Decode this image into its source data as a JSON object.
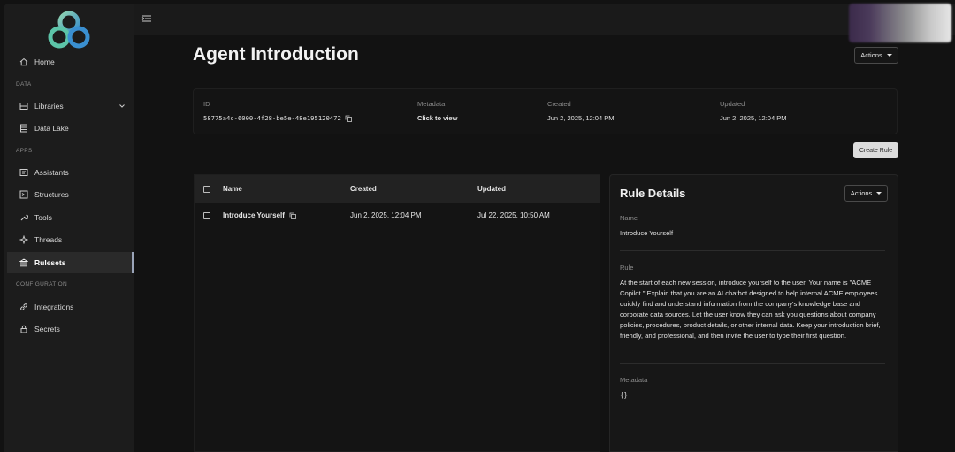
{
  "sidebar": {
    "items": [
      {
        "label": "Home",
        "icon": "home-icon"
      },
      {
        "label": "Libraries",
        "icon": "libraries-icon"
      },
      {
        "label": "Data Lake",
        "icon": "data-lake-icon"
      },
      {
        "label": "Assistants",
        "icon": "assistants-icon"
      },
      {
        "label": "Structures",
        "icon": "structures-icon"
      },
      {
        "label": "Tools",
        "icon": "tools-icon"
      },
      {
        "label": "Threads",
        "icon": "threads-icon"
      },
      {
        "label": "Rulesets",
        "icon": "rulesets-icon",
        "active": true
      },
      {
        "label": "Integrations",
        "icon": "integrations-icon"
      },
      {
        "label": "Secrets",
        "icon": "lock-icon"
      }
    ],
    "sections": {
      "data": "DATA",
      "apps": "APPS",
      "configuration": "CONFIGURATION"
    }
  },
  "page": {
    "title": "Agent Introduction",
    "actions_label": "Actions",
    "create_rule_label": "Create Rule"
  },
  "info": {
    "id_label": "ID",
    "id_value": "58775a4c-6000-4f28-be5e-48e195120472",
    "metadata_label": "Metadata",
    "metadata_value": "Click to view",
    "created_label": "Created",
    "created_value": "Jun 2, 2025, 12:04 PM",
    "updated_label": "Updated",
    "updated_value": "Jun 2, 2025, 12:04 PM"
  },
  "table": {
    "columns": {
      "name": "Name",
      "created": "Created",
      "updated": "Updated"
    },
    "rows": [
      {
        "name": "Introduce Yourself",
        "created": "Jun 2, 2025, 12:04 PM",
        "updated": "Jul 22, 2025, 10:50 AM"
      }
    ]
  },
  "details": {
    "title": "Rule Details",
    "actions_label": "Actions",
    "name_label": "Name",
    "name_value": "Introduce Yourself",
    "rule_label": "Rule",
    "rule_value": "At the start of each new session, introduce yourself to the user. Your name is \"ACME Copilot.\" Explain that you are an AI chatbot designed to help internal ACME employees quickly find and understand information from the company's knowledge base and corporate data sources. Let the user know they can ask you questions about company policies, procedures, product details, or other internal data. Keep your introduction brief, friendly, and professional, and then invite the user to type their first question.",
    "metadata_label": "Metadata",
    "metadata_value": "{}"
  },
  "colors": {
    "accent": "#4bb0c9",
    "sidebar_bg": "#1c1c1c",
    "page_bg": "#121212"
  }
}
